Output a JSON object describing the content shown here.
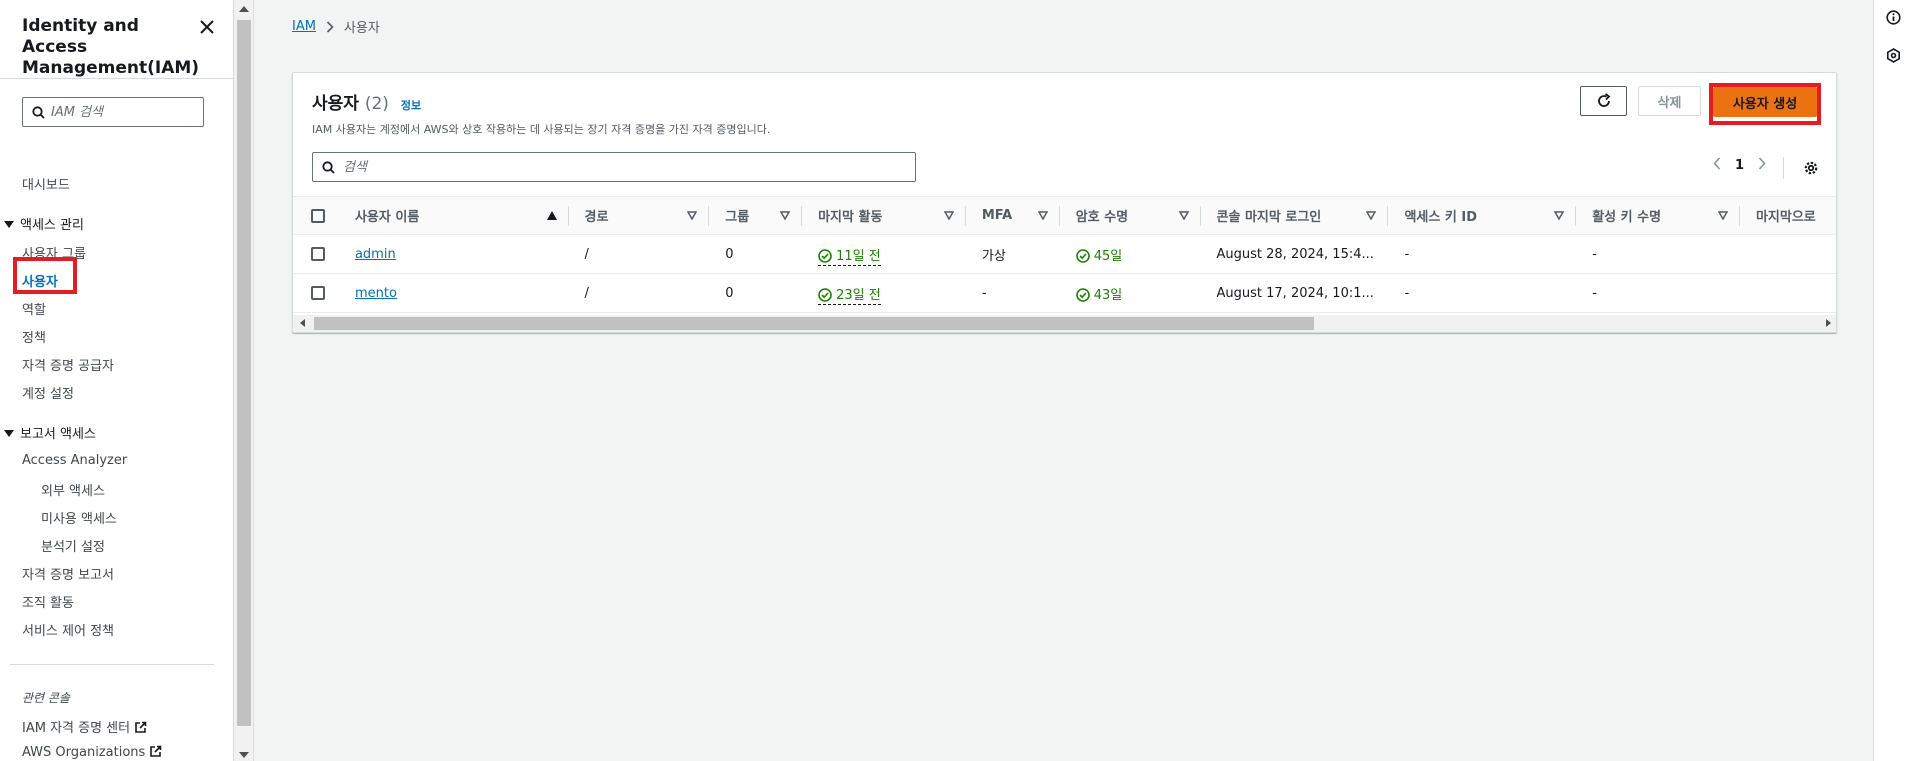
{
  "sidebar": {
    "title": "Identity and Access Management(IAM)",
    "search_placeholder": "IAM 검색",
    "dashboard": "대시보드",
    "access_mgmt": {
      "label": "액세스 관리",
      "items": [
        "사용자 그룹",
        "사용자",
        "역할",
        "정책",
        "자격 증명 공급자",
        "계정 설정"
      ]
    },
    "report_access": {
      "label": "보고서 액세스",
      "analyzer": "Access Analyzer",
      "sub_items": [
        "외부 액세스",
        "미사용 액세스",
        "분석기 설정"
      ],
      "items": [
        "자격 증명 보고서",
        "조직 활동",
        "서비스 제어 정책"
      ]
    },
    "related": {
      "label": "관련 콘솔",
      "items": [
        "IAM 자격 증명 센터",
        "AWS Organizations"
      ]
    }
  },
  "breadcrumb": {
    "root": "IAM",
    "current": "사용자"
  },
  "panel": {
    "title": "사용자",
    "count": "(2)",
    "info": "정보",
    "description": "IAM 사용자는 계정에서 AWS와 상호 작용하는 데 사용되는 장기 자격 증명을 가진 자격 증명입니다.",
    "delete_label": "삭제",
    "create_label": "사용자 생성",
    "search_placeholder": "검색",
    "page": "1"
  },
  "table": {
    "columns": [
      "사용자 이름",
      "경로",
      "그룹",
      "마지막 활동",
      "MFA",
      "암호 수명",
      "콘솔 마지막 로그인",
      "액세스 키 ID",
      "활성 키 수명",
      "마지막으로"
    ],
    "rows": [
      {
        "name": "admin",
        "path": "/",
        "groups": "0",
        "last_activity": "11일 전",
        "mfa": "가상",
        "password_age": "45일",
        "console_last_login": "August 28, 2024, 15:4...",
        "access_key_id": "-",
        "active_key_age": "-",
        "last": ""
      },
      {
        "name": "mento",
        "path": "/",
        "groups": "0",
        "last_activity": "23일 전",
        "mfa": "-",
        "password_age": "43일",
        "console_last_login": "August 17, 2024, 10:1...",
        "access_key_id": "-",
        "active_key_age": "-",
        "last": ""
      }
    ]
  },
  "colors": {
    "accent": "#0073bb",
    "primary_button": "#ec7211",
    "success": "#1d8102",
    "highlight": "#e41c23"
  }
}
